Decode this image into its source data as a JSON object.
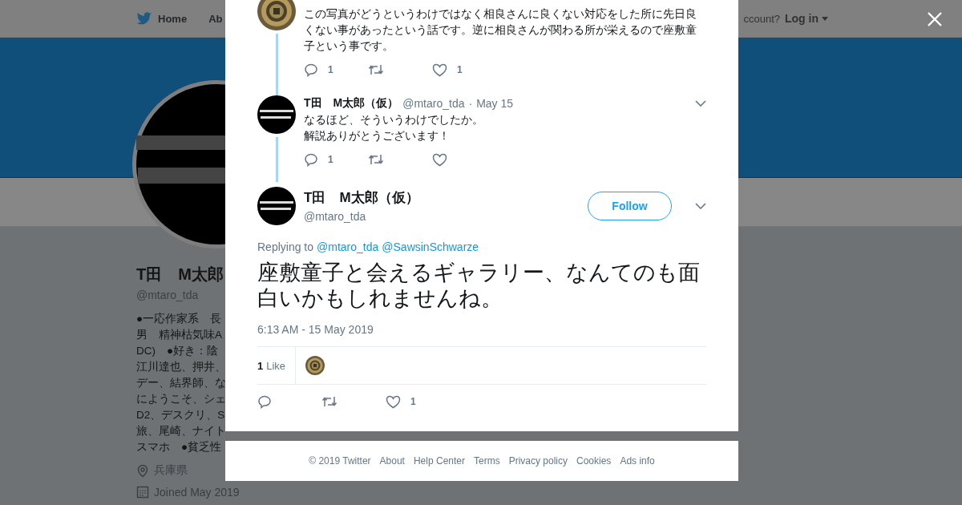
{
  "background_page": {
    "nav": {
      "items": [
        {
          "label": "Home",
          "kind": "home"
        },
        {
          "label": "Ab",
          "kind": "plain"
        }
      ],
      "account_prompt": "ccount?",
      "login": "Log in"
    },
    "profile": {
      "name": "T田　M太郎",
      "handle": "@mtaro_tda",
      "bio_lines": [
        "●一応作家系　長",
        "男　精神枯気味A",
        "DC)　●好き：陰",
        "江川達也、押井、",
        "デー、結界師、な",
        "にようこそ、シェ",
        "D2、デスクリ、S",
        "旅、尾崎、ナイト",
        "スマホ　●貧乏性"
      ],
      "location": "兵庫県",
      "joined": "Joined May 2019"
    }
  },
  "modal": {
    "thread": [
      {
        "kind": "cut",
        "text": "この写真がどうというわけではなく相良さんに良くない対応をした所に先日良くない事があったという話です。逆に相良さんが関わる所が栄えるので座敷童子という事です。",
        "reply_count": "1",
        "like_count": "1"
      },
      {
        "kind": "full",
        "name": "T田　M太郎（仮）",
        "handle": "@mtaro_tda",
        "separator": "·",
        "date": "May 15",
        "text_lines": [
          "なるほど、そういうわけでしたか。",
          "解説ありがとうございます！"
        ],
        "reply_count": "1"
      }
    ],
    "main_tweet": {
      "name": "T田　M太郎（仮）",
      "handle": "@mtaro_tda",
      "follow": "Follow",
      "replying_label": "Replying to",
      "replying_to": [
        "@mtaro_tda",
        "@SawsinSchwarze"
      ],
      "text": "座敷童子と会えるギャラリー、なんてのも面白いかもしれませんね。",
      "timestamp": "6:13 AM - 15 May 2019",
      "likes_count": "1",
      "likes_label": "Like",
      "like_count": "1"
    },
    "footer_links": [
      "© 2019 Twitter",
      "About",
      "Help Center",
      "Terms",
      "Privacy policy",
      "Cookies",
      "Ads info"
    ]
  }
}
